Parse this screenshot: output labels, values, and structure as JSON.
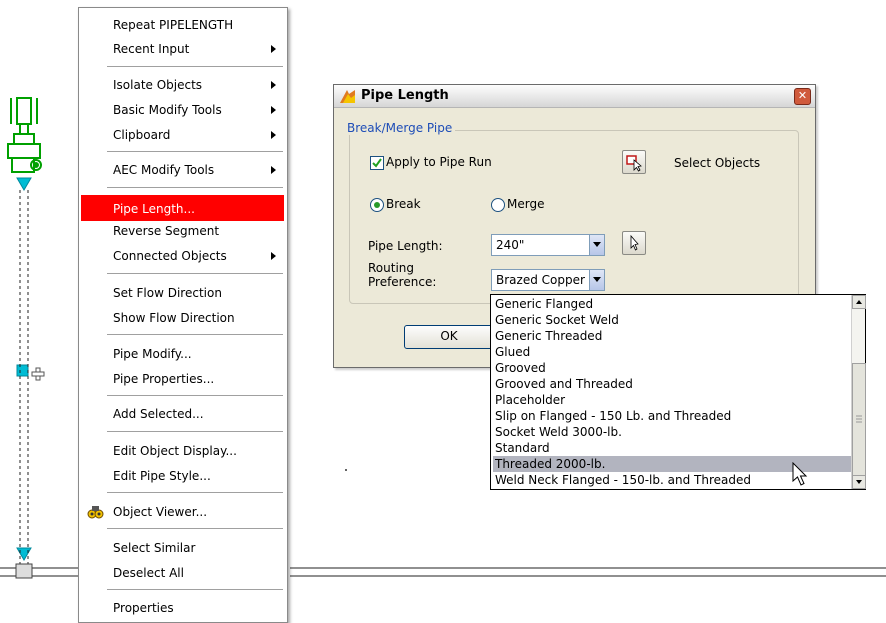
{
  "context_menu": {
    "items": [
      {
        "label": "Repeat PIPELENGTH",
        "submenu": false
      },
      {
        "label": "Recent Input",
        "submenu": true
      },
      {
        "label": "Isolate Objects",
        "submenu": true
      },
      {
        "label": "Basic Modify Tools",
        "submenu": true
      },
      {
        "label": "Clipboard",
        "submenu": true
      },
      {
        "label": "AEC Modify Tools",
        "submenu": true
      },
      {
        "label": "Pipe Length...",
        "submenu": false,
        "highlighted": true
      },
      {
        "label": "Reverse Segment",
        "submenu": false
      },
      {
        "label": "Connected Objects",
        "submenu": true
      },
      {
        "label": "Set Flow Direction",
        "submenu": false
      },
      {
        "label": "Show Flow Direction",
        "submenu": false
      },
      {
        "label": "Pipe Modify...",
        "submenu": false
      },
      {
        "label": "Pipe Properties...",
        "submenu": false
      },
      {
        "label": "Add Selected...",
        "submenu": false
      },
      {
        "label": "Edit Object Display...",
        "submenu": false
      },
      {
        "label": "Edit Pipe Style...",
        "submenu": false
      },
      {
        "label": "Object Viewer...",
        "submenu": false
      },
      {
        "label": "Select Similar",
        "submenu": false
      },
      {
        "label": "Deselect All",
        "submenu": false
      },
      {
        "label": "Properties",
        "submenu": false
      }
    ],
    "highlight_color": "#ff0000"
  },
  "dialog": {
    "title": "Pipe Length",
    "group_label": "Break/Merge Pipe",
    "apply_to_pipe_run": {
      "label": "Apply to Pipe Run",
      "checked": true
    },
    "select_objects_label": "Select Objects",
    "mode": {
      "break_label": "Break",
      "merge_label": "Merge",
      "selected": "Break"
    },
    "pipe_length": {
      "label": "Pipe Length:",
      "value": "240\""
    },
    "routing_preference": {
      "label_line1": "Routing",
      "label_line2": "Preference:",
      "value": "Brazed Copper"
    },
    "ok_label": "OK",
    "accent_color": "#1e4db7"
  },
  "dropdown": {
    "options": [
      "Generic Flanged",
      "Generic Socket Weld",
      "Generic Threaded",
      "Glued",
      "Grooved",
      "Grooved and Threaded",
      "Placeholder",
      "Slip on Flanged - 150 Lb. and Threaded",
      "Socket Weld 3000-lb.",
      "Standard",
      "Threaded 2000-lb.",
      "Weld Neck Flanged - 150-lb. and Threaded"
    ],
    "selected": "Threaded 2000-lb."
  },
  "icons": {
    "menu_object_viewer": "object-viewer-icon",
    "close": "close-icon",
    "select_objects": "select-objects-icon",
    "pick_length": "pick-point-icon",
    "dialog_app": "pipe-length-app-icon"
  },
  "colors": {
    "pipe": "#00a000",
    "marker": "#00bcd4"
  }
}
